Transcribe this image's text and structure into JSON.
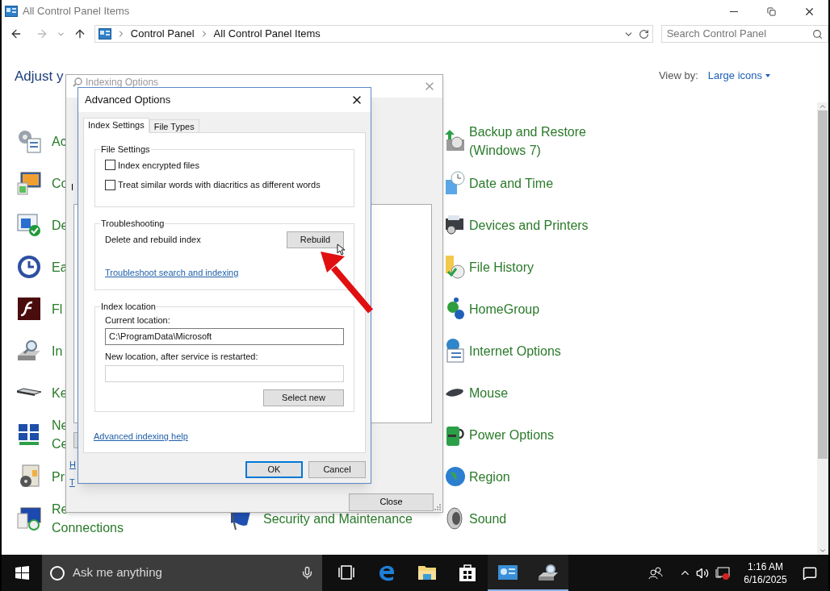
{
  "window": {
    "title": "All Control Panel Items"
  },
  "address_bar": {
    "segments": [
      "Control Panel",
      "All Control Panel Items"
    ]
  },
  "search": {
    "placeholder": "Search Control Panel"
  },
  "header": {
    "title": "Adjust y",
    "view_by_label": "View by:",
    "view_by_value": "Large icons"
  },
  "items": {
    "column_1": [
      {
        "lines": [
          "Ac"
        ]
      },
      {
        "lines": [
          "Co"
        ]
      },
      {
        "lines": [
          "De"
        ]
      },
      {
        "lines": [
          "Ea"
        ]
      },
      {
        "lines": [
          "Fl"
        ]
      },
      {
        "lines": [
          "In"
        ]
      },
      {
        "lines": [
          "Ke"
        ]
      },
      {
        "lines": [
          "Ne",
          "Ce"
        ]
      },
      {
        "lines": [
          "Pr"
        ]
      },
      {
        "lines": [
          "Re",
          "Connections"
        ]
      }
    ],
    "column_2": [
      {
        "lines": [
          "Security and Maintenance"
        ]
      }
    ],
    "column_3": [
      {
        "lines": [
          "Backup and Restore",
          "(Windows 7)"
        ]
      },
      {
        "lines": [
          "Date and Time"
        ]
      },
      {
        "lines": [
          "Devices and Printers"
        ]
      },
      {
        "lines": [
          "File History"
        ]
      },
      {
        "lines": [
          "HomeGroup"
        ]
      },
      {
        "lines": [
          "Internet Options"
        ]
      },
      {
        "lines": [
          "Mouse"
        ]
      },
      {
        "lines": [
          "Power Options"
        ]
      },
      {
        "lines": [
          "Region"
        ]
      },
      {
        "lines": [
          "Sound"
        ]
      }
    ]
  },
  "indexing_dialog": {
    "title": "Indexing Options",
    "label_fragment": "I",
    "links": [
      "H",
      "T"
    ],
    "close_button": "Close"
  },
  "advanced_dialog": {
    "title": "Advanced Options",
    "tabs": [
      {
        "label": "Index Settings",
        "selected": true
      },
      {
        "label": "File Types",
        "selected": false
      }
    ],
    "file_settings": {
      "title": "File Settings",
      "checkboxes": [
        {
          "label": "Index encrypted files",
          "checked": false
        },
        {
          "label": "Treat similar words with diacritics as different words",
          "checked": false
        }
      ]
    },
    "troubleshooting": {
      "title": "Troubleshooting",
      "text": "Delete and rebuild index",
      "button": "Rebuild",
      "link": "Troubleshoot search and indexing"
    },
    "index_location": {
      "title": "Index location",
      "current_label": "Current location:",
      "current_value": "C:\\ProgramData\\Microsoft",
      "new_label": "New location, after service is restarted:",
      "button": "Select new"
    },
    "help_link": "Advanced indexing help",
    "buttons": [
      {
        "label": "OK",
        "default": true
      },
      {
        "label": "Cancel",
        "default": false
      }
    ]
  },
  "taskbar": {
    "search_placeholder": "Ask me anything",
    "apps": [
      {
        "kind": "task-view",
        "active": false
      },
      {
        "kind": "browser",
        "active": false
      },
      {
        "kind": "file-explorer",
        "active": false
      },
      {
        "kind": "store",
        "active": false
      },
      {
        "kind": "control-panel",
        "active": true
      },
      {
        "kind": "indexing",
        "active": true
      }
    ],
    "clock": {
      "time": "1:16 AM",
      "date": "6/16/2025"
    }
  }
}
